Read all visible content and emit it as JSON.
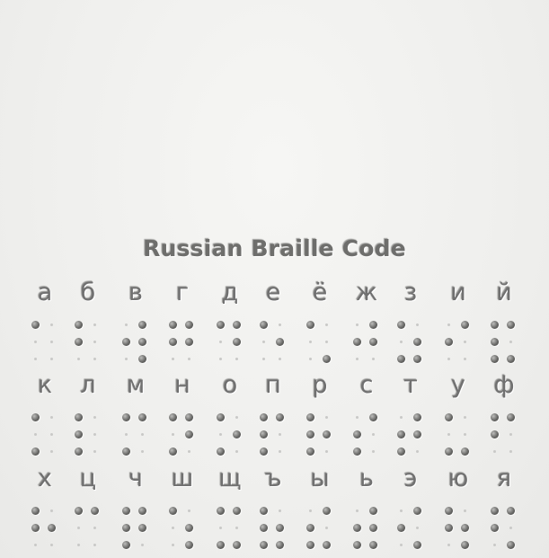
{
  "title": "Russian Braille Code",
  "rows": [
    [
      {
        "letter": "а",
        "dots": [
          1
        ]
      },
      {
        "letter": "б",
        "dots": [
          1,
          2
        ]
      },
      {
        "letter": "в",
        "dots": [
          2,
          4,
          5,
          6
        ]
      },
      {
        "letter": "г",
        "dots": [
          1,
          2,
          4,
          5
        ]
      },
      {
        "letter": "д",
        "dots": [
          1,
          4,
          5
        ]
      },
      {
        "letter": "е",
        "dots": [
          1,
          5
        ]
      },
      {
        "letter": "ё",
        "dots": [
          1,
          6
        ]
      },
      {
        "letter": "ж",
        "dots": [
          2,
          4,
          5
        ]
      },
      {
        "letter": "з",
        "dots": [
          1,
          3,
          5,
          6
        ]
      },
      {
        "letter": "и",
        "dots": [
          2,
          4
        ]
      },
      {
        "letter": "й",
        "dots": [
          1,
          2,
          3,
          4,
          6
        ]
      }
    ],
    [
      {
        "letter": "к",
        "dots": [
          1,
          3
        ]
      },
      {
        "letter": "л",
        "dots": [
          1,
          2,
          3
        ]
      },
      {
        "letter": "м",
        "dots": [
          1,
          3,
          4
        ]
      },
      {
        "letter": "н",
        "dots": [
          1,
          3,
          4,
          5
        ]
      },
      {
        "letter": "о",
        "dots": [
          1,
          3,
          5
        ]
      },
      {
        "letter": "п",
        "dots": [
          1,
          2,
          3,
          4
        ]
      },
      {
        "letter": "р",
        "dots": [
          1,
          2,
          3,
          5
        ]
      },
      {
        "letter": "с",
        "dots": [
          2,
          3,
          4
        ]
      },
      {
        "letter": "т",
        "dots": [
          2,
          3,
          4,
          5
        ]
      },
      {
        "letter": "у",
        "dots": [
          1,
          3,
          6
        ]
      },
      {
        "letter": "ф",
        "dots": [
          1,
          2,
          4
        ]
      }
    ],
    [
      {
        "letter": "х",
        "dots": [
          1,
          2,
          5
        ]
      },
      {
        "letter": "ц",
        "dots": [
          1,
          4
        ]
      },
      {
        "letter": "ч",
        "dots": [
          1,
          2,
          3,
          4,
          5
        ]
      },
      {
        "letter": "ш",
        "dots": [
          1,
          5,
          6
        ]
      },
      {
        "letter": "щ",
        "dots": [
          1,
          3,
          4,
          6
        ]
      },
      {
        "letter": "ъ",
        "dots": [
          1,
          2,
          3,
          5,
          6
        ]
      },
      {
        "letter": "ы",
        "dots": [
          2,
          3,
          4,
          6
        ]
      },
      {
        "letter": "ь",
        "dots": [
          2,
          3,
          4,
          5,
          6
        ]
      },
      {
        "letter": "э",
        "dots": [
          2,
          4,
          6
        ]
      },
      {
        "letter": "ю",
        "dots": [
          1,
          2,
          5,
          6
        ]
      },
      {
        "letter": "я",
        "dots": [
          1,
          2,
          4,
          6
        ]
      }
    ]
  ]
}
